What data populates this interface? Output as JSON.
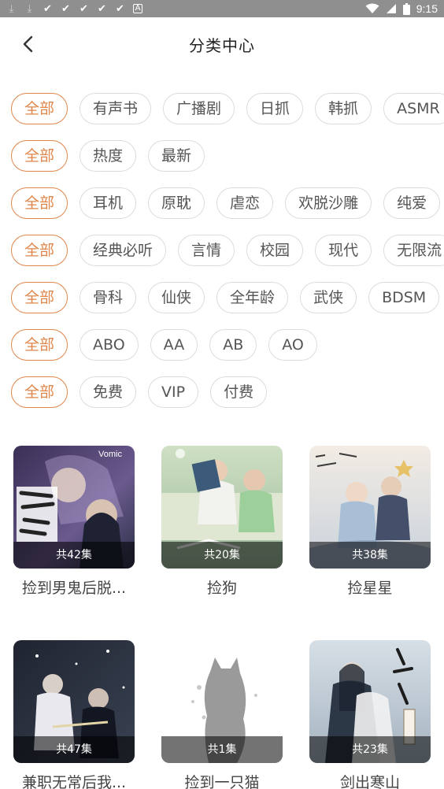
{
  "statusbar": {
    "time": "9:15",
    "left_icons": [
      "download-icon",
      "download-icon",
      "check-icon",
      "check-icon",
      "check-icon",
      "check-icon",
      "check-icon",
      "app-a-icon"
    ],
    "right_icons": [
      "wifi-icon",
      "signal-icon",
      "battery-icon"
    ]
  },
  "header": {
    "back_icon": "chevron-left-icon",
    "title": "分类中心"
  },
  "filters": [
    {
      "options": [
        "全部",
        "有声书",
        "广播剧",
        "日抓",
        "韩抓",
        "ASMR"
      ]
    },
    {
      "options": [
        "全部",
        "热度",
        "最新"
      ]
    },
    {
      "options": [
        "全部",
        "耳机",
        "原耽",
        "虐恋",
        "欢脱沙雕",
        "纯爱"
      ]
    },
    {
      "options": [
        "全部",
        "经典必听",
        "言情",
        "校园",
        "现代",
        "无限流"
      ]
    },
    {
      "options": [
        "全部",
        "骨科",
        "仙侠",
        "全年龄",
        "武侠",
        "BDSM"
      ]
    },
    {
      "options": [
        "全部",
        "ABO",
        "AA",
        "AB",
        "AO"
      ]
    },
    {
      "options": [
        "全部",
        "免费",
        "VIP",
        "付费"
      ]
    }
  ],
  "accent_color": "#e0864a",
  "cards": [
    {
      "title": "捡到男鬼后脱...",
      "count": "共42集",
      "cover_text": "Vomic"
    },
    {
      "title": "捡狗",
      "count": "共20集",
      "cover_text": ""
    },
    {
      "title": "捡星星",
      "count": "共38集",
      "cover_text": ""
    },
    {
      "title": "兼职无常后我...",
      "count": "共47集",
      "cover_text": ""
    },
    {
      "title": "捡到一只猫",
      "count": "共1集",
      "cover_text": ""
    },
    {
      "title": "剑出寒山",
      "count": "共23集",
      "cover_text": ""
    }
  ]
}
